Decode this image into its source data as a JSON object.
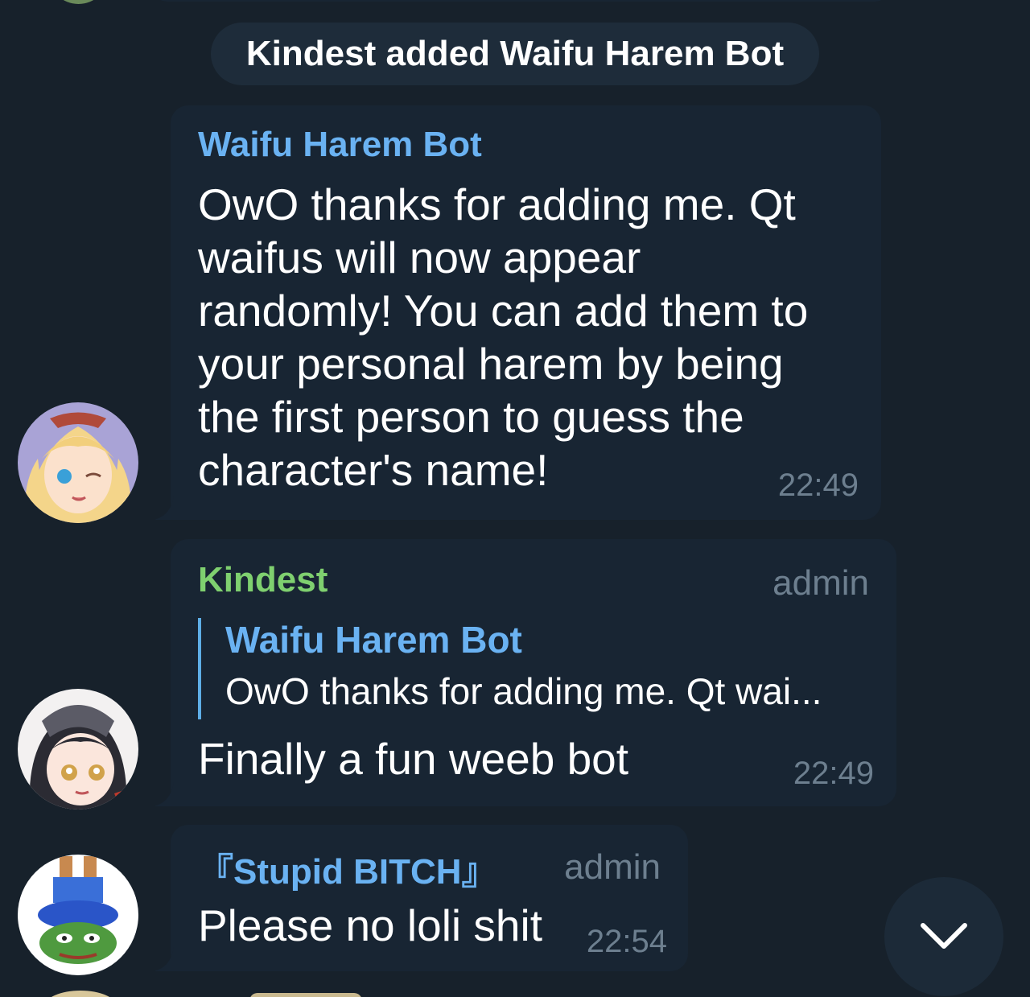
{
  "service_message": "Kindest added Waifu Harem Bot",
  "messages": [
    {
      "sender": "Waifu Harem Bot",
      "sender_color": "#6ab2f2",
      "text": "OwO thanks for adding me. Qt\nwaifus will now appear\nrandomly! You can add them to\nyour personal harem by being\nthe first person to guess the\ncharacter's name!",
      "time": "22:49"
    },
    {
      "sender": "Kindest",
      "sender_color": "#7fd06f",
      "admin_tag": "admin",
      "reply": {
        "sender": "Waifu Harem Bot",
        "text": "OwO thanks for adding me. Qt wai..."
      },
      "text": "Finally a fun weeb bot",
      "time": "22:49"
    },
    {
      "sender": "『Stupid BITCH』",
      "sender_color": "#6ab2f2",
      "admin_tag": "admin",
      "text": "Please no loli shit",
      "time": "22:54"
    }
  ],
  "scroll_button_icon": "chevron-down-icon",
  "colors": {
    "background": "#17212b",
    "bubble": "#182533",
    "meta_text": "#6d7f8f",
    "reply_bar": "#5eaee7"
  }
}
